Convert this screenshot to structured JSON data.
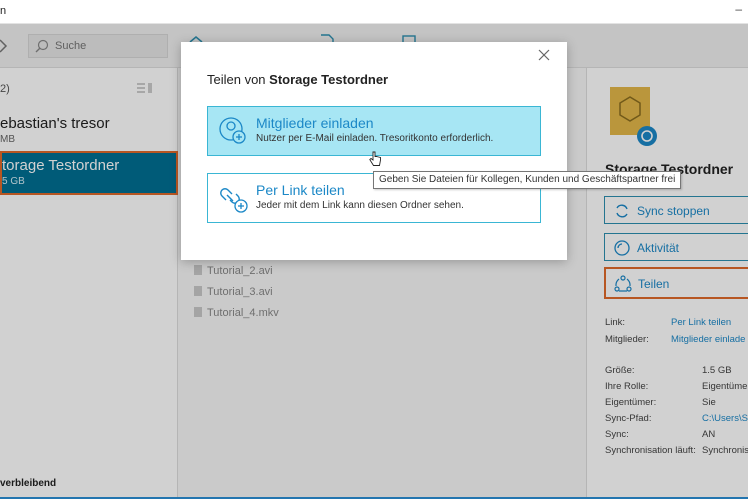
{
  "window": {
    "title": "n",
    "minimize_glyph": "–"
  },
  "search": {
    "placeholder": "Suche"
  },
  "left": {
    "count_label": "2)",
    "tresors": [
      {
        "name": "ebastian's tresor",
        "size": "MB"
      },
      {
        "name": "torage Testordner",
        "size": "5 GB"
      }
    ],
    "remaining_label": "verbleibend"
  },
  "files": [
    "Tutorial_2.avi",
    "Tutorial_3.avi",
    "Tutorial_4.mkv"
  ],
  "right": {
    "folder_name": "Storage Testordner",
    "buttons": {
      "sync_stop": "Sync stoppen",
      "activity": "Aktivität",
      "share": "Teilen"
    },
    "info": {
      "link_label": "Link:",
      "link_value": "Per Link teilen",
      "members_label": "Mitglieder:",
      "members_value": "Mitglieder einlade",
      "size_label": "Größe:",
      "size_value": "1.5 GB",
      "role_label": "Ihre Rolle:",
      "role_value": "Eigentümer",
      "owner_label": "Eigentümer:",
      "owner_value": "Sie",
      "path_label": "Sync-Pfad:",
      "path_value": "C:\\Users\\Se",
      "sync_label": "Sync:",
      "sync_value": "AN",
      "syncrun_label": "Synchronisation läuft:",
      "syncrun_value": "Synchronis"
    }
  },
  "modal": {
    "title_prefix": "Teilen von",
    "title_name": "Storage Testordner",
    "options": [
      {
        "title": "Mitglieder einladen",
        "desc": "Nutzer per E-Mail einladen. Tresoritkonto erforderlich."
      },
      {
        "title": "Per Link teilen",
        "desc": "Jeder mit dem Link kann diesen Ordner sehen."
      }
    ]
  },
  "tooltip": {
    "text": "Geben Sie Dateien für Kollegen, Kunden und Geschäftspartner frei"
  },
  "colors": {
    "accent": "#1c88c7",
    "selected_bg": "#006f93",
    "highlight": "#e06a2a",
    "option_bg": "#a7e6f4"
  }
}
